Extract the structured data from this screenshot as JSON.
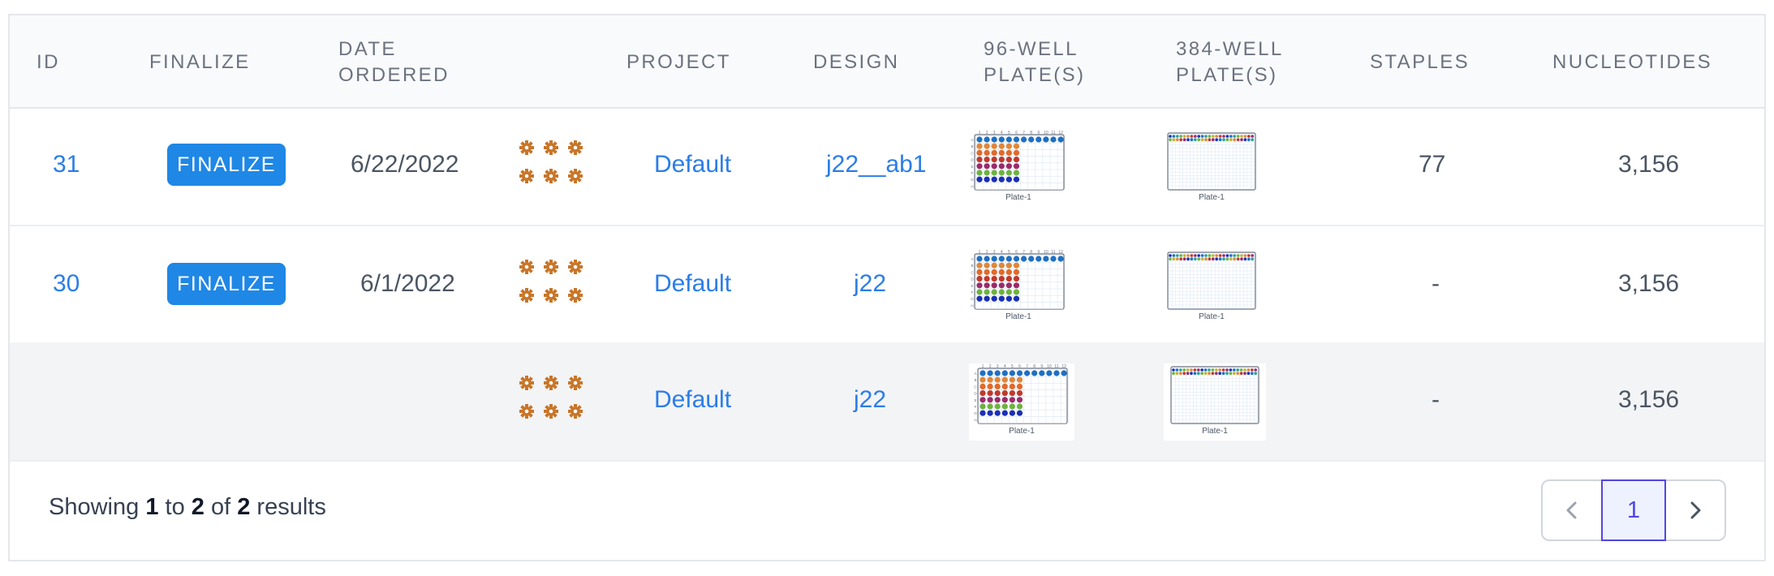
{
  "columns": {
    "id": "ID",
    "finalize": "FINALIZE",
    "date_1": "DATE",
    "date_2": "ORDERED",
    "project": "PROJECT",
    "design": "DESIGN",
    "plate96_1": "96-WELL",
    "plate96_2": "PLATE(S)",
    "plate384_1": "384-WELL",
    "plate384_2": "PLATE(S)",
    "staples": "STAPLES",
    "nucleotides": "NUCLEOTIDES"
  },
  "rows": [
    {
      "id": "31",
      "finalize_label": "FINALIZE",
      "date": "6/22/2022",
      "project": "Default",
      "design": "j22__ab1",
      "plate96_label": "Plate-1",
      "plate384_label": "Plate-1",
      "staples": "77",
      "nucleotides": "3,156"
    },
    {
      "id": "30",
      "finalize_label": "FINALIZE",
      "date": "6/1/2022",
      "project": "Default",
      "design": "j22",
      "plate96_label": "Plate-1",
      "plate384_label": "Plate-1",
      "staples": "-",
      "nucleotides": "3,156"
    },
    {
      "id": "",
      "finalize_label": "",
      "date": "",
      "project": "Default",
      "design": "j22",
      "plate96_label": "Plate-1",
      "plate384_label": "Plate-1",
      "staples": "-",
      "nucleotides": "3,156"
    }
  ],
  "footer": {
    "showing": "Showing",
    "from": "1",
    "to_word": "to",
    "to": "2",
    "of_word": "of",
    "total": "2",
    "results_word": "results",
    "current_page": "1"
  },
  "icons": {
    "gear": "gear-icon",
    "prev": "chevron-left-icon",
    "next": "chevron-right-icon"
  },
  "colors": {
    "link": "#2b7de9",
    "button": "#1f87e5",
    "gear": "#c8762a",
    "pager_active": "#4f46e5"
  },
  "plate96_well_rows": [
    "#1f6fc2",
    "#e0873a",
    "#e06a2c",
    "#c0392b",
    "#9b2b6a",
    "#6db33f",
    "#1b2fb5"
  ]
}
